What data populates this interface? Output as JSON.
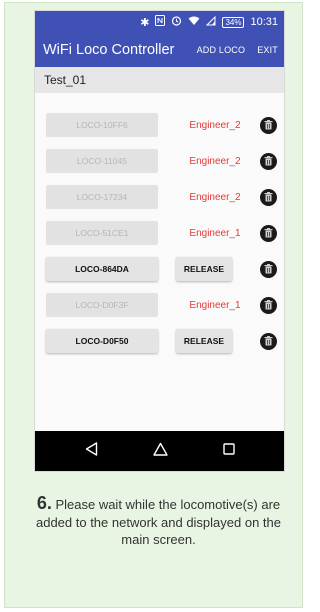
{
  "status_bar": {
    "time": "10:31",
    "battery": "34%",
    "icons": [
      "bluetooth-icon",
      "nfc-icon",
      "alarm-icon",
      "wifi-icon",
      "signal-icon",
      "battery-icon"
    ]
  },
  "app_bar": {
    "title": "WiFi Loco Controller",
    "add_loco_label": "ADD LOCO",
    "exit_label": "EXIT"
  },
  "subheader": {
    "text": "Test_01"
  },
  "locos": [
    {
      "name": "LOCO-10FF6",
      "enabled": false,
      "owner": "Engineer_2",
      "action": null
    },
    {
      "name": "LOCO-11045",
      "enabled": false,
      "owner": "Engineer_2",
      "action": null
    },
    {
      "name": "LOCO-17234",
      "enabled": false,
      "owner": "Engineer_2",
      "action": null
    },
    {
      "name": "LOCO-51CE1",
      "enabled": false,
      "owner": "Engineer_1",
      "action": null
    },
    {
      "name": "LOCO-864DA",
      "enabled": true,
      "owner": null,
      "action": "RELEASE"
    },
    {
      "name": "LOCO-D0F3F",
      "enabled": false,
      "owner": "Engineer_1",
      "action": null
    },
    {
      "name": "LOCO-D0F50",
      "enabled": true,
      "owner": null,
      "action": "RELEASE"
    }
  ],
  "nav_bar": {
    "icons": [
      "back-icon",
      "home-icon",
      "recents-icon"
    ]
  },
  "caption": {
    "step_number": "6.",
    "text": "Please wait while the locomotive(s) are added to the network and displayed on the main screen."
  },
  "colors": {
    "primary": "#3f51b5",
    "owner_text": "#e53935",
    "card_background": "#e8f5e2"
  }
}
